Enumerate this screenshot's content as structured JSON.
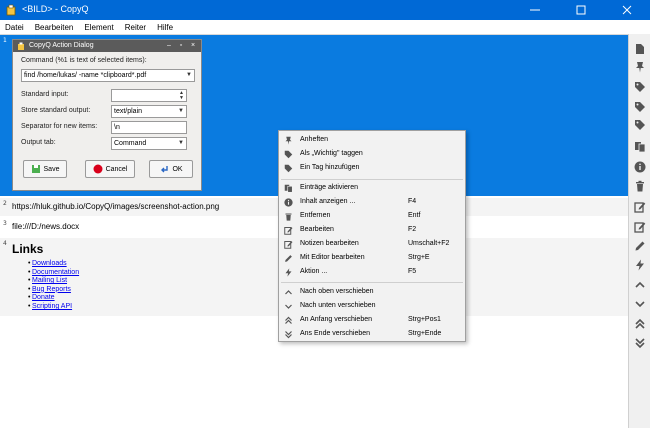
{
  "window": {
    "title": "<BILD> - CopyQ"
  },
  "menu": [
    "Datei",
    "Bearbeiten",
    "Element",
    "Reiter",
    "Hilfe"
  ],
  "items": {
    "item1": {
      "index": "1"
    },
    "item2": {
      "index": "2",
      "text": "https://hluk.github.io/CopyQ/images/screenshot-action.png"
    },
    "item3": {
      "index": "3",
      "text": "file:///D:/news.docx"
    },
    "item4": {
      "index": "4",
      "heading": "Links",
      "links": [
        "Downloads",
        "Documentation",
        "Mailing List",
        "Bug Reports",
        "Donate",
        "Scripting API"
      ]
    }
  },
  "dialog": {
    "title": "CopyQ Action Dialog",
    "command_label": "Command (%1 is text of selected items):",
    "command_value": "find /home/lukas/ -name *clipboard*.pdf",
    "standard_input_label": "Standard input:",
    "standard_input_value": "",
    "store_output_label": "Store standard output:",
    "store_output_value": "text/plain",
    "separator_label": "Separator for new items:",
    "separator_value": "\\n",
    "output_tab_label": "Output tab:",
    "output_tab_value": "Command",
    "save": "Save",
    "cancel": "Cancel",
    "ok": "OK"
  },
  "context_menu": [
    {
      "icon": "pin-icon",
      "label": "Anheften",
      "shortcut": ""
    },
    {
      "icon": "tag-icon",
      "label": "Als „Wichtig\" taggen",
      "shortcut": ""
    },
    {
      "icon": "tag-icon",
      "label": "Ein Tag hinzufügen",
      "shortcut": ""
    },
    {
      "icon": "copy-icon",
      "label": "Einträge aktivieren",
      "shortcut": ""
    },
    {
      "icon": "info-icon",
      "label": "Inhalt anzeigen ...",
      "shortcut": "F4"
    },
    {
      "icon": "trash-icon",
      "label": "Entfernen",
      "shortcut": "Entf"
    },
    {
      "icon": "edit-icon",
      "label": "Bearbeiten",
      "shortcut": "F2"
    },
    {
      "icon": "notes-icon",
      "label": "Notizen bearbeiten",
      "shortcut": "Umschalt+F2"
    },
    {
      "icon": "pencil-icon",
      "label": "Mit Editor bearbeiten",
      "shortcut": "Strg+E"
    },
    {
      "icon": "bolt-icon",
      "label": "Aktion ...",
      "shortcut": "F5"
    },
    {
      "icon": "chevron-up-icon",
      "label": "Nach oben verschieben",
      "shortcut": ""
    },
    {
      "icon": "chevron-down-icon",
      "label": "Nach unten verschieben",
      "shortcut": ""
    },
    {
      "icon": "double-up-icon",
      "label": "An Anfang verschieben",
      "shortcut": "Strg+Pos1"
    },
    {
      "icon": "double-down-icon",
      "label": "Ans Ende verschieben",
      "shortcut": "Strg+Ende"
    }
  ],
  "toolbar": [
    "new-item-icon",
    "pin-icon",
    "tag-icon",
    "tag-icon",
    "tag-icon",
    "copy-icon",
    "info-icon",
    "trash-icon",
    "edit-icon",
    "notes-icon",
    "pencil-icon",
    "bolt-icon",
    "chevron-up-icon",
    "chevron-down-icon",
    "double-up-icon",
    "double-down-icon"
  ],
  "colors": {
    "titlebar": "#0069d6",
    "selection": "#0a7be0",
    "icon": "#555555"
  }
}
